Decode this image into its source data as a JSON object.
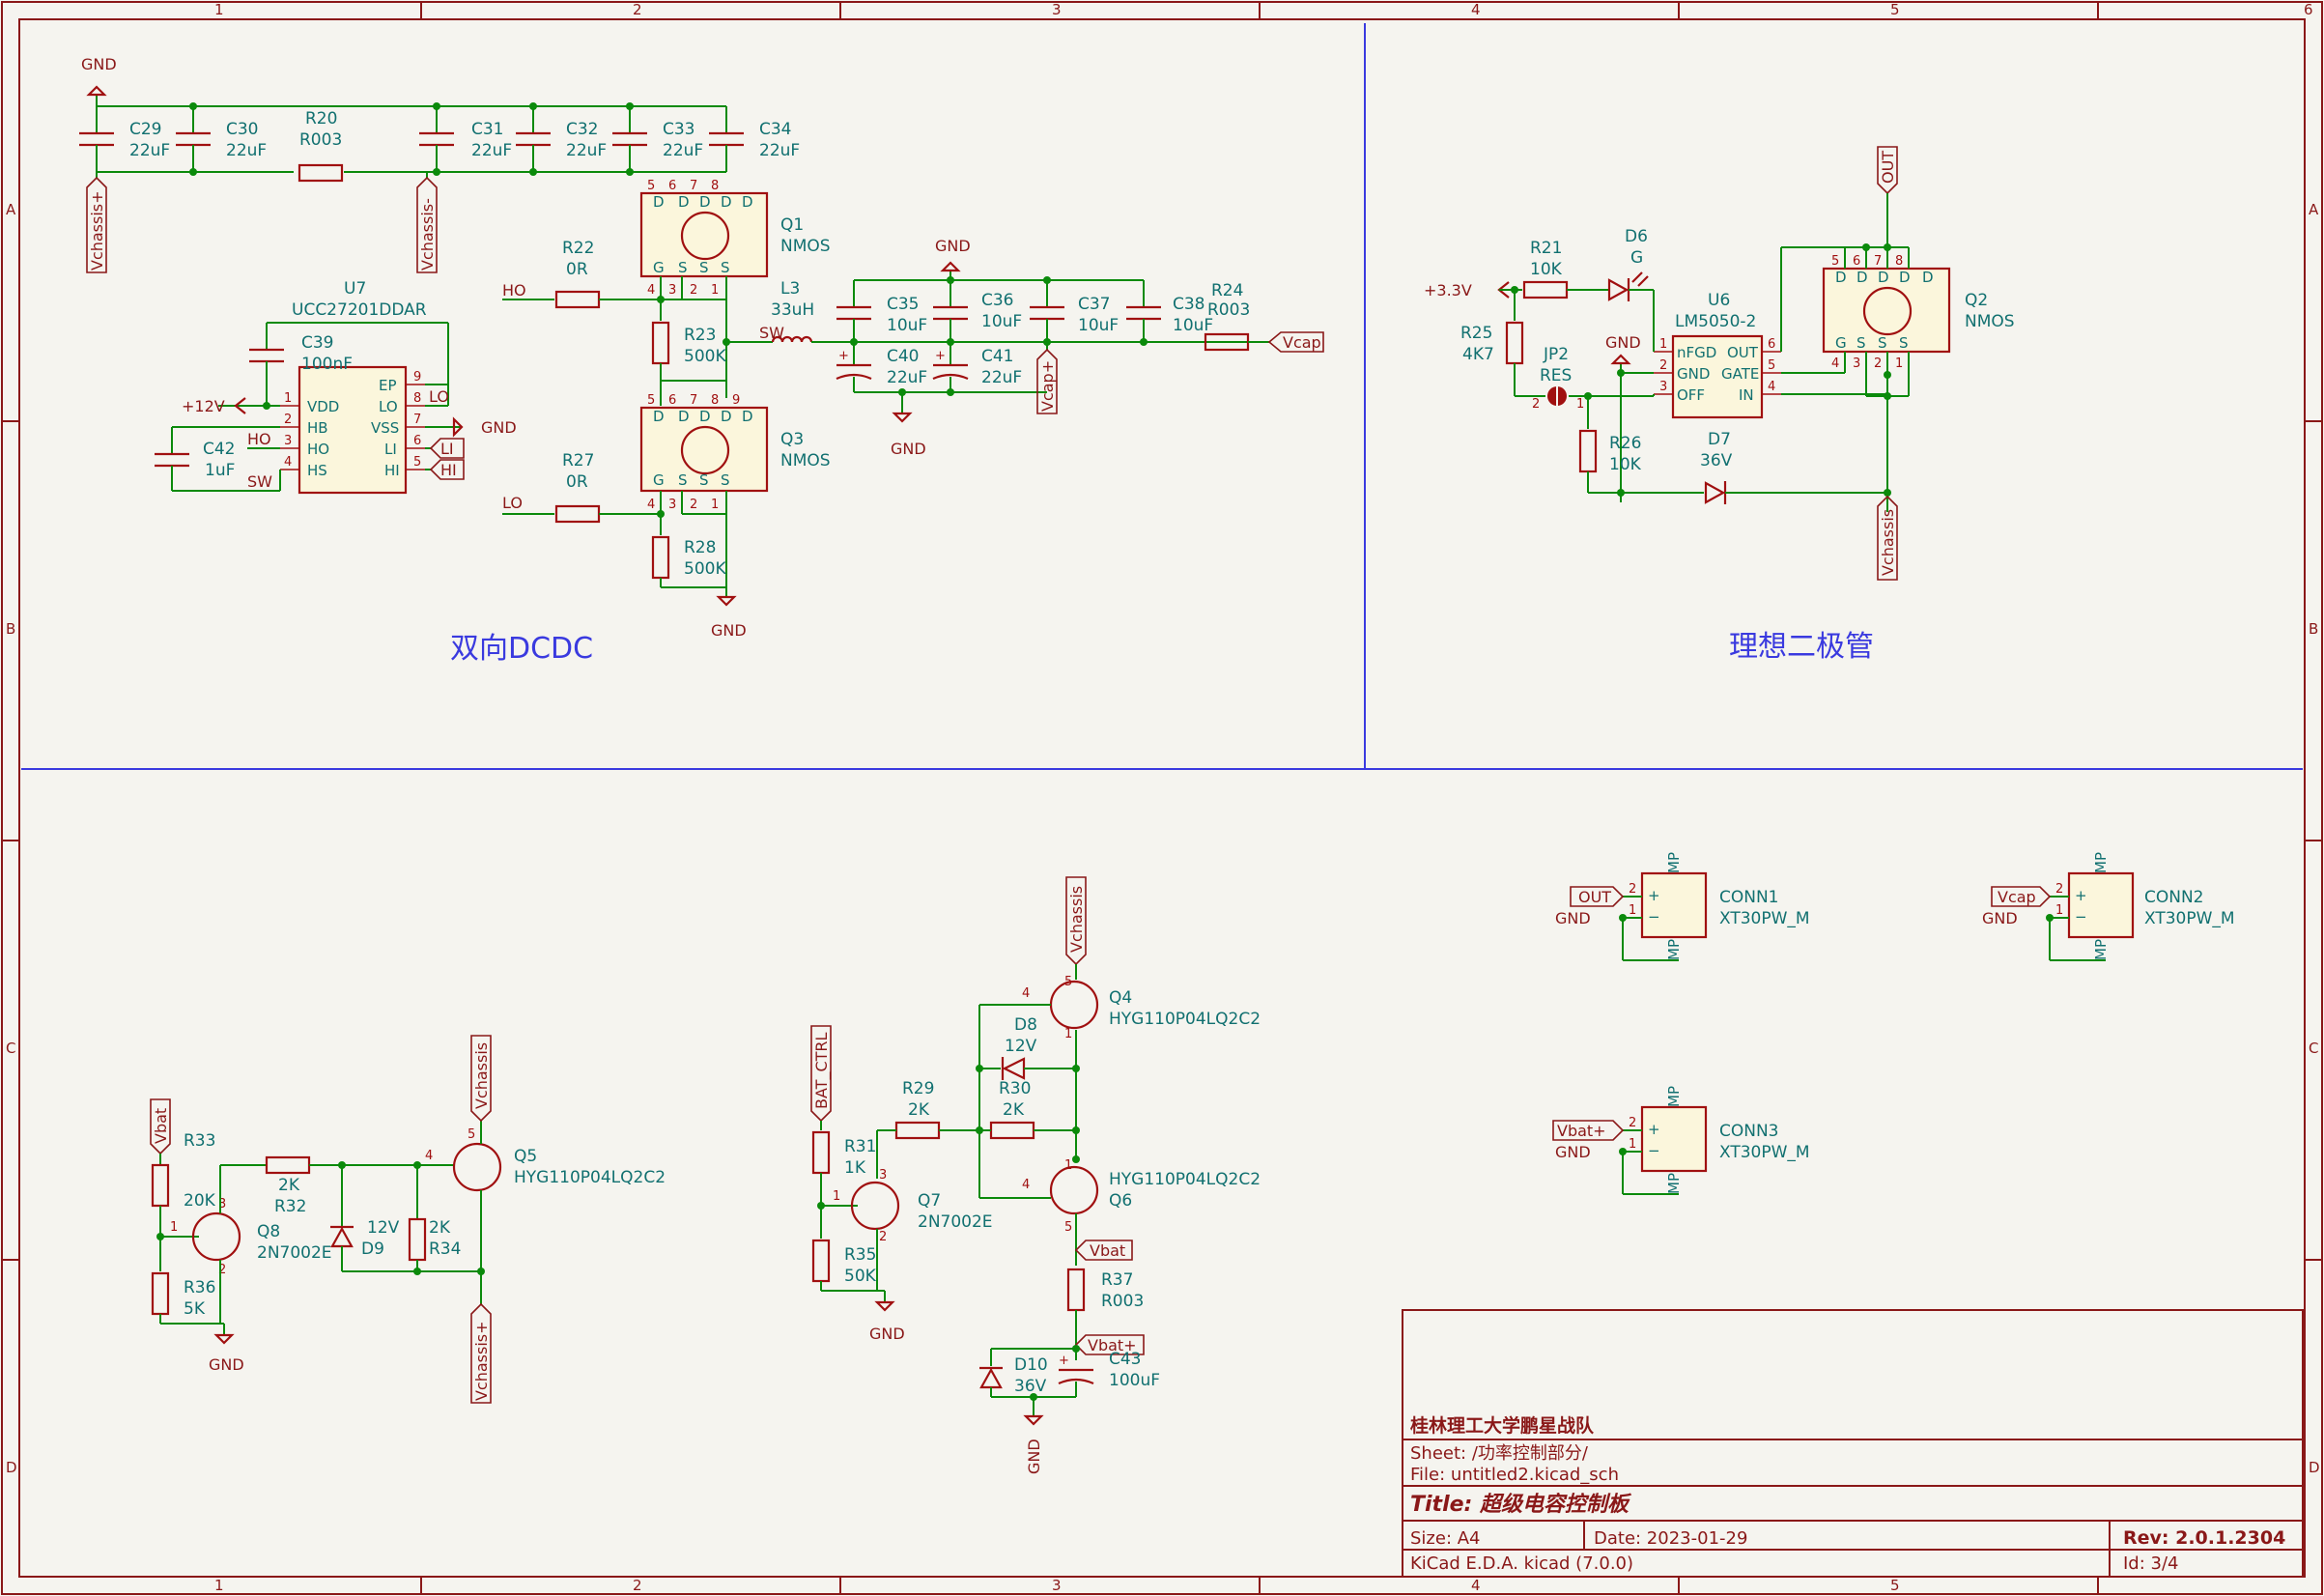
{
  "border": {
    "columns": [
      "1",
      "2",
      "3",
      "4",
      "5",
      "6"
    ],
    "rows": [
      "A",
      "B",
      "C",
      "D"
    ]
  },
  "sections": {
    "dcdc_title": "双向DCDC",
    "ideal_diode_title": "理想二极管"
  },
  "nets": {
    "gnd": "GND",
    "vchassis_plus": "Vchassis+",
    "vchassis_minus": "Vchassis-",
    "vchassis": "Vchassis",
    "ho": "HO",
    "lo": "LO",
    "sw": "SW",
    "li": "LI",
    "hi": "HI",
    "plus12v": "+12V",
    "vcap": "Vcap",
    "vcap_plus": "Vcap+",
    "out": "OUT",
    "plus3v3": "+3.3V",
    "vbat": "Vbat",
    "vbat_plus": "Vbat+",
    "bat_ctrl": "BAT_CTRL"
  },
  "components": {
    "C29": {
      "ref": "C29",
      "val": "22uF"
    },
    "C30": {
      "ref": "C30",
      "val": "22uF"
    },
    "R20": {
      "ref": "R20",
      "val": "R003"
    },
    "C31": {
      "ref": "C31",
      "val": "22uF"
    },
    "C32": {
      "ref": "C32",
      "val": "22uF"
    },
    "C33": {
      "ref": "C33",
      "val": "22uF"
    },
    "C34": {
      "ref": "C34",
      "val": "22uF"
    },
    "Q1": {
      "ref": "Q1",
      "val": "NMOS"
    },
    "Q3": {
      "ref": "Q3",
      "val": "NMOS"
    },
    "R22": {
      "ref": "R22",
      "val": "0R"
    },
    "R23": {
      "ref": "R23",
      "val": "500K"
    },
    "R27": {
      "ref": "R27",
      "val": "0R"
    },
    "R28": {
      "ref": "R28",
      "val": "500K"
    },
    "L3": {
      "ref": "L3",
      "val": "33uH"
    },
    "C35": {
      "ref": "C35",
      "val": "10uF"
    },
    "C36": {
      "ref": "C36",
      "val": "10uF"
    },
    "C37": {
      "ref": "C37",
      "val": "10uF"
    },
    "C38": {
      "ref": "C38",
      "val": "10uF"
    },
    "C40": {
      "ref": "C40",
      "val": "22uF"
    },
    "C41": {
      "ref": "C41",
      "val": "22uF"
    },
    "R24": {
      "ref": "R24",
      "val": "R003"
    },
    "U7": {
      "ref": "U7",
      "val": "UCC27201DDAR"
    },
    "C39": {
      "ref": "C39",
      "val": "100nF"
    },
    "C42": {
      "ref": "C42",
      "val": "1uF"
    },
    "U6": {
      "ref": "U6",
      "val": "LM5050-2"
    },
    "Q2": {
      "ref": "Q2",
      "val": "NMOS"
    },
    "R21": {
      "ref": "R21",
      "val": "10K"
    },
    "D6": {
      "ref": "D6",
      "val": "G"
    },
    "R25": {
      "ref": "R25",
      "val": "4K7"
    },
    "JP2": {
      "ref": "JP2",
      "val": "RES"
    },
    "R26": {
      "ref": "R26",
      "val": "10K"
    },
    "D7": {
      "ref": "D7",
      "val": "36V"
    },
    "CONN1": {
      "ref": "CONN1",
      "val": "XT30PW_M"
    },
    "CONN2": {
      "ref": "CONN2",
      "val": "XT30PW_M"
    },
    "CONN3": {
      "ref": "CONN3",
      "val": "XT30PW_M"
    },
    "Q4": {
      "ref": "Q4",
      "val": "HYG110P04LQ2C2"
    },
    "Q6": {
      "ref": "Q6",
      "val": "HYG110P04LQ2C2"
    },
    "Q5": {
      "ref": "Q5",
      "val": "HYG110P04LQ2C2"
    },
    "Q7": {
      "ref": "Q7",
      "val": "2N7002E"
    },
    "Q8": {
      "ref": "Q8",
      "val": "2N7002E"
    },
    "D8": {
      "ref": "D8",
      "val": "12V"
    },
    "D9": {
      "ref": "D9",
      "val": "12V"
    },
    "D10": {
      "ref": "D10",
      "val": "36V"
    },
    "R29": {
      "ref": "R29",
      "val": "2K"
    },
    "R30": {
      "ref": "R30",
      "val": "2K"
    },
    "R31": {
      "ref": "R31",
      "val": "1K"
    },
    "R35": {
      "ref": "R35",
      "val": "50K"
    },
    "R37": {
      "ref": "R37",
      "val": "R003"
    },
    "C43": {
      "ref": "C43",
      "val": "100uF"
    },
    "R33": {
      "ref": "R33",
      "val": "20K"
    },
    "R32": {
      "ref": "R32",
      "val": "2K"
    },
    "R34": {
      "ref": "R34",
      "val": "2K"
    },
    "R36": {
      "ref": "R36",
      "val": "5K"
    }
  },
  "u7_pins": {
    "vdd": "VDD",
    "hb": "HB",
    "ho": "HO",
    "hs": "HS",
    "ep": "EP",
    "lo": "LO",
    "vss": "VSS",
    "li": "LI",
    "hi": "HI"
  },
  "u6_pins": {
    "nfgd": "nFGD",
    "gnd": "GND",
    "off": "OFF",
    "out": "OUT",
    "gate": "GATE",
    "in": "IN"
  },
  "mos_pins": {
    "d": "D",
    "s": "S",
    "g": "G"
  },
  "conn_pins": {
    "plus": "+",
    "minus": "−",
    "mp": "MP"
  },
  "title_block": {
    "company": "桂林理工大学鹏星战队",
    "sheet": "Sheet: /功率控制部分/",
    "file": "File: untitled2.kicad_sch",
    "title": "Title: 超级电容控制板",
    "size": "Size: A4",
    "date": "Date: 2023-01-29",
    "rev": "Rev: 2.0.1.2304",
    "tool": "KiCad E.D.A.  kicad (7.0.0)",
    "id": "Id: 3/4"
  }
}
